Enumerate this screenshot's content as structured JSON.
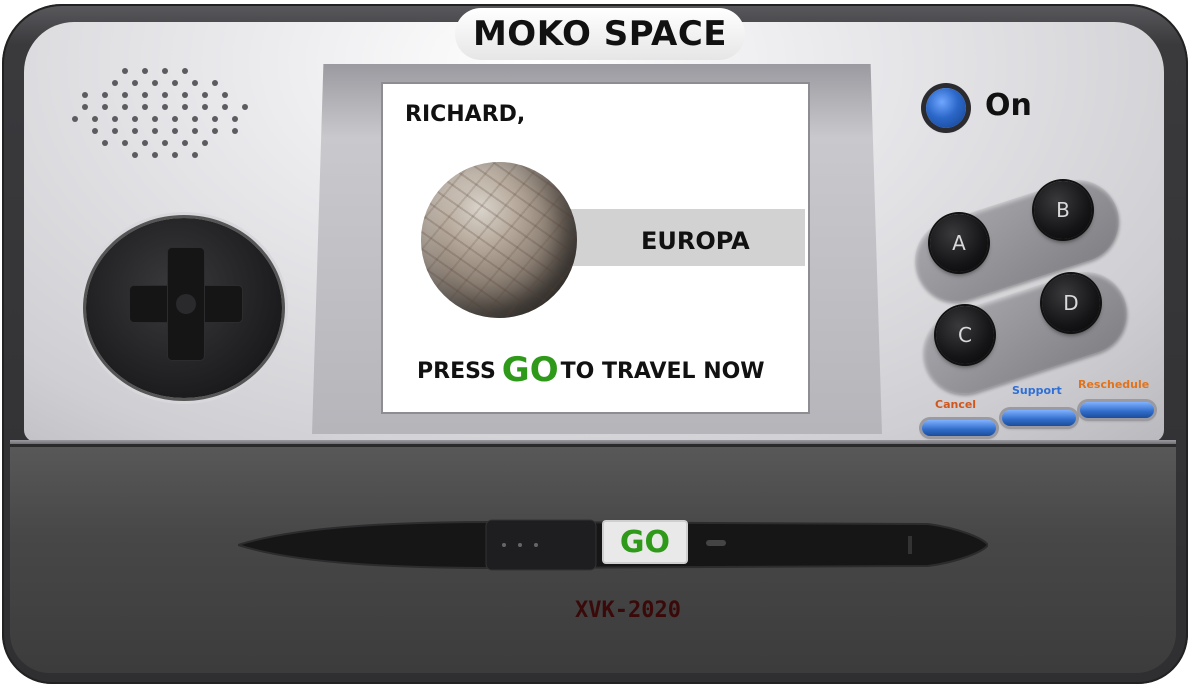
{
  "brand": {
    "title": "MOKO SPACE"
  },
  "power": {
    "label": "On",
    "color": "#2c68c9"
  },
  "screen": {
    "greeting": "RICHARD,",
    "destination": "EUROPA",
    "prompt_before": "PRESS",
    "prompt_go": "GO",
    "prompt_after": "TO TRAVEL NOW",
    "planet_icon": "europa-planet-icon"
  },
  "action_buttons": [
    "A",
    "B",
    "C",
    "D"
  ],
  "small_buttons": [
    {
      "label": "Cancel",
      "color": "#d0561c"
    },
    {
      "label": "Support",
      "color": "#2f6fd6"
    },
    {
      "label": "Reschedule",
      "color": "#e0731c"
    }
  ],
  "go_button": {
    "label": "GO",
    "color": "#2f9a1a"
  },
  "model": {
    "code": "XVK-2020"
  }
}
